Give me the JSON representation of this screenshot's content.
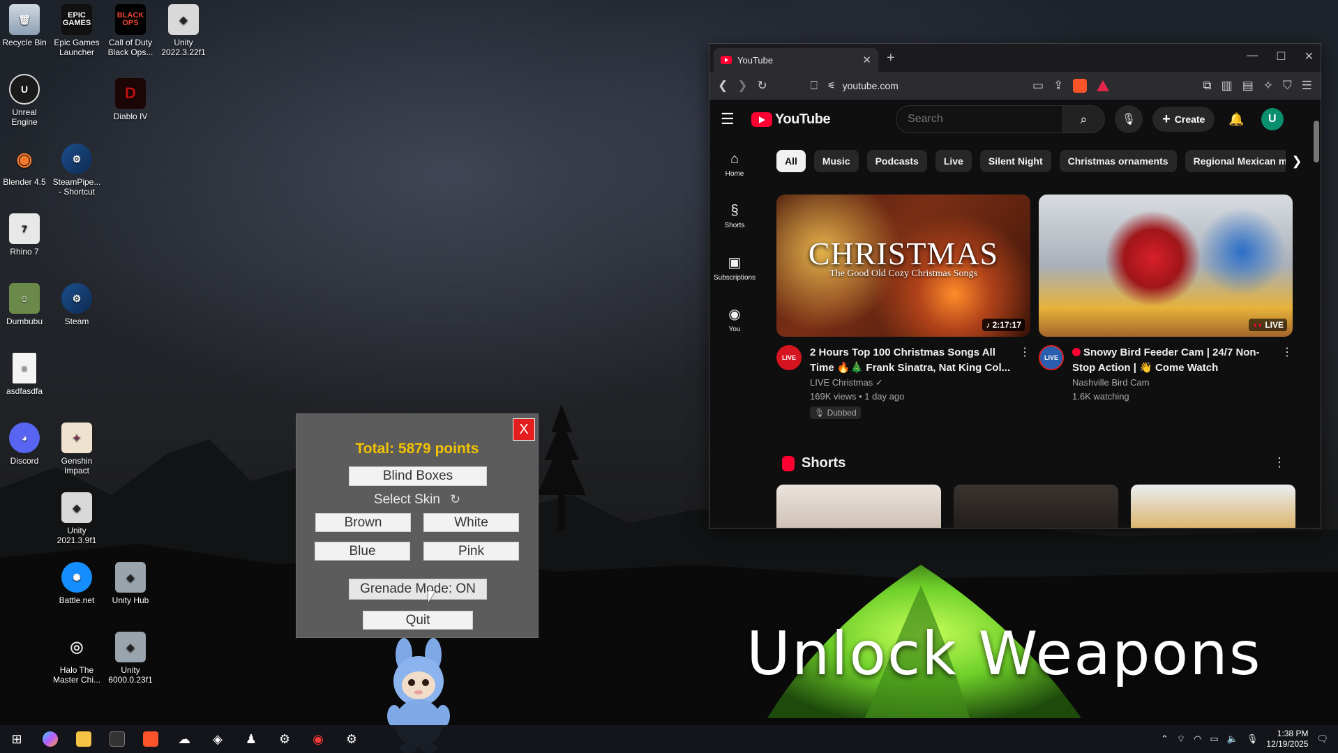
{
  "desktop": {
    "icons": [
      {
        "label": "Recycle Bin",
        "icon": "recycle-bin-icon"
      },
      {
        "label": "Epic Games Launcher",
        "icon": "epic-games-icon",
        "glyph": "EPIC GAMES"
      },
      {
        "label": "Call of Duty Black Ops...",
        "icon": "call-of-duty-icon",
        "glyph": "BLACK OPS"
      },
      {
        "label": "Unity 2022.3.22f1",
        "icon": "unity-icon"
      },
      {
        "label": "Unreal Engine",
        "icon": "unreal-engine-icon"
      },
      {
        "label": "Diablo IV",
        "icon": "diablo-icon"
      },
      {
        "label": "Blender 4.5",
        "icon": "blender-icon"
      },
      {
        "label": "SteamPipe... - Shortcut",
        "icon": "steam-icon"
      },
      {
        "label": "Rhino 7",
        "icon": "rhino-icon"
      },
      {
        "label": "Dumbubu",
        "icon": "dumbubu-icon"
      },
      {
        "label": "Steam",
        "icon": "steam-icon"
      },
      {
        "label": "asdfasdfa",
        "icon": "text-file-icon"
      },
      {
        "label": "Discord",
        "icon": "discord-icon"
      },
      {
        "label": "Genshin Impact",
        "icon": "genshin-icon"
      },
      {
        "label": "Unity 2021.3.9f1",
        "icon": "unity-icon"
      },
      {
        "label": "Battle.net",
        "icon": "battlenet-icon"
      },
      {
        "label": "Unity Hub",
        "icon": "unity-hub-icon"
      },
      {
        "label": "Halo The Master Chi...",
        "icon": "halo-icon"
      },
      {
        "label": "Unity 6000.0.23f1",
        "icon": "unity-icon"
      }
    ]
  },
  "browser": {
    "tab_title": "YouTube",
    "tab_close": "✕",
    "new_tab": "+",
    "url": "youtube.com"
  },
  "youtube": {
    "logo_text": "YouTube",
    "search_placeholder": "Search",
    "create_label": "Create",
    "avatar_letter": "U",
    "sidebar": [
      {
        "label": "Home",
        "glyph": "⌂"
      },
      {
        "label": "Shorts",
        "glyph": "§"
      },
      {
        "label": "Subscriptions",
        "glyph": "▣"
      },
      {
        "label": "You",
        "glyph": "◉"
      }
    ],
    "chips": [
      "All",
      "Music",
      "Podcasts",
      "Live",
      "Silent Night",
      "Christmas ornaments",
      "Regional Mexican musi"
    ],
    "videos": [
      {
        "thumb_title": "CHRISTMAS",
        "thumb_subtitle": "The Good Old Cozy Christmas Songs",
        "duration": "♪ 2:17:17",
        "channel_avatar_text": "LIVE",
        "title": "2 Hours Top 100 Christmas Songs All Time 🔥🎄 Frank Sinatra, Nat King Col...",
        "channel": "LIVE Christmas ✓",
        "stats": "169K views • 1 day ago",
        "badge": "Dubbed"
      },
      {
        "live_label": "LIVE",
        "channel_avatar_text": "LIVE",
        "title": "Snowy Bird Feeder Cam | 24/7 Non-Stop Action | 👋 Come Watch",
        "channel": "Nashville Bird Cam",
        "stats": "1.6K watching"
      }
    ],
    "shorts_title": "Shorts"
  },
  "game_panel": {
    "total": "Total: 5879 points",
    "blind_boxes": "Blind Boxes",
    "select_skin": "Select Skin",
    "skins": [
      "Brown",
      "White",
      "Blue",
      "Pink"
    ],
    "grenade_mode": "Grenade Mode: ON",
    "quit": "Quit",
    "close": "X"
  },
  "overlay_caption": "Unlock Weapons",
  "taskbar": {
    "time": "1:38 PM",
    "date": "12/19/2025"
  }
}
